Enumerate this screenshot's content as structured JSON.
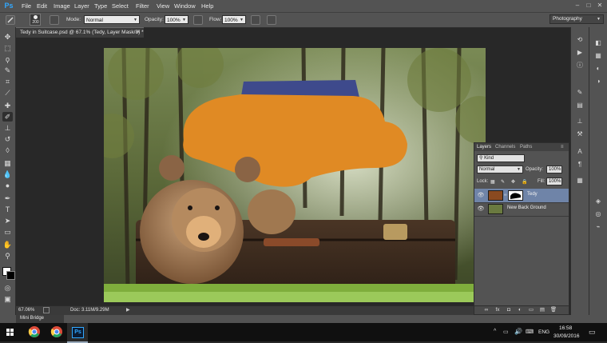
{
  "app": {
    "logo": "Ps",
    "menu": [
      "File",
      "Edit",
      "Image",
      "Layer",
      "Type",
      "Select",
      "Filter",
      "View",
      "Window",
      "Help"
    ]
  },
  "options_bar": {
    "brush_size": "200",
    "mode_label": "Mode:",
    "mode_value": "Normal",
    "opacity_label": "Opacity:",
    "opacity_value": "100%",
    "flow_label": "Flow:",
    "flow_value": "100%"
  },
  "workspace": "Photography",
  "document": {
    "tab_title": "Tedy in Suitcase.psd @ 67.1% (Tedy, Layer Mask/8) *",
    "zoom": "67.06%",
    "doc_size": "Doc: 3.11M/9.29M"
  },
  "mini_bridge": "Mini Bridge",
  "layers_panel": {
    "tabs": [
      "Layers",
      "Channels",
      "Paths"
    ],
    "filter_kind": "Kind",
    "blend_mode": "Normal",
    "opacity_label": "Opacity:",
    "opacity_value": "100%",
    "lock_label": "Lock:",
    "fill_label": "Fill:",
    "fill_value": "100%",
    "layers": [
      {
        "name": "Tedy",
        "selected": true
      },
      {
        "name": "New Back Ground",
        "selected": false
      }
    ]
  },
  "taskbar": {
    "lang": "ENG",
    "time": "16:58",
    "date": "30/09/2016"
  },
  "colors": {
    "accent": "#31a8ff",
    "selected_layer": "#6f84a8",
    "ui_panel": "#535353"
  },
  "tool_icons": [
    "move-icon",
    "marquee-icon",
    "lasso-icon",
    "quick-select-icon",
    "crop-icon",
    "eyedropper-icon",
    "healing-icon",
    "brush-icon",
    "clone-stamp-icon",
    "history-brush-icon",
    "eraser-icon",
    "gradient-icon",
    "blur-icon",
    "dodge-icon",
    "pen-icon",
    "type-icon",
    "path-select-icon",
    "shape-icon",
    "hand-icon",
    "zoom-icon"
  ]
}
